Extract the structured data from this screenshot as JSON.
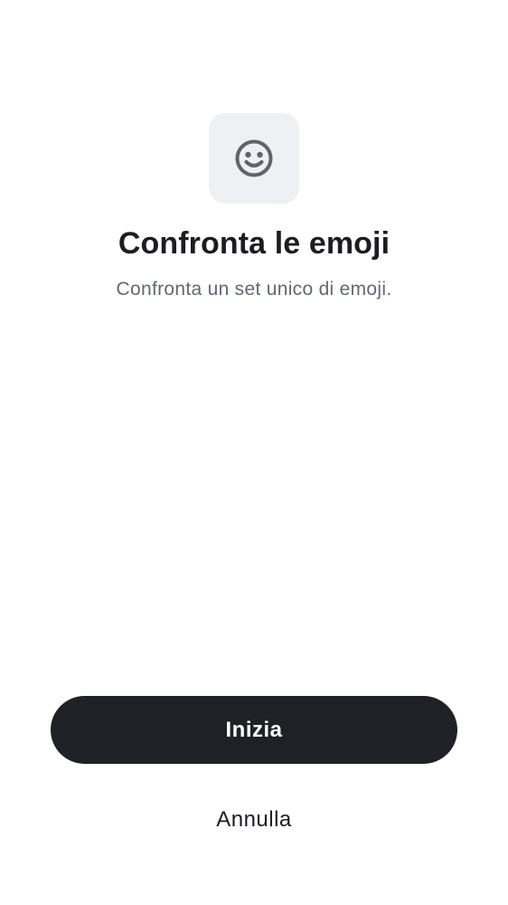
{
  "header": {
    "icon": "smiley-face-icon",
    "title": "Confronta le emoji",
    "subtitle": "Confronta un set unico di emoji."
  },
  "actions": {
    "primary_label": "Inizia",
    "secondary_label": "Annulla"
  },
  "colors": {
    "background": "#ffffff",
    "icon_tile": "#eff0f3",
    "icon": "#5f636c",
    "primary_button": "#202126",
    "title_text": "#1c1d22",
    "subtitle_text": "#616875"
  }
}
